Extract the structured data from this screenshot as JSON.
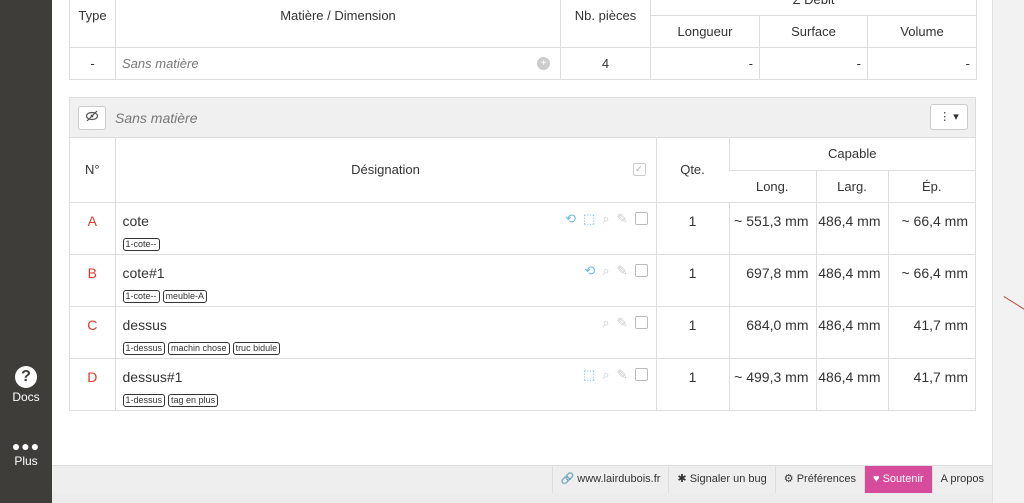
{
  "sidebar": {
    "docs_label": "Docs",
    "docs_icon": "question-icon",
    "plus_label": "Plus",
    "plus_icon": "more-dots-icon"
  },
  "summary": {
    "headers": {
      "type": "Type",
      "material": "Matière / Dimension",
      "count": "Nb. pièces",
      "debit_group": "Σ Débit",
      "length": "Longueur",
      "surface": "Surface",
      "volume": "Volume"
    },
    "row": {
      "type": "-",
      "material": "Sans matière",
      "count": "4",
      "length": "-",
      "surface": "-",
      "volume": "-"
    }
  },
  "group": {
    "title": "Sans matière",
    "headers": {
      "number": "N°",
      "designation": "Désignation",
      "qty": "Qte.",
      "capable": "Capable",
      "long": "Long.",
      "larg": "Larg.",
      "ep": "Ép."
    },
    "parts": [
      {
        "number": "A",
        "name": "cote",
        "tags": [
          "1-cote--"
        ],
        "icons": [
          "rotate-icon",
          "dimension-icon"
        ],
        "qty": "1",
        "long": "~ 551,3 mm",
        "larg": "486,4 mm",
        "ep": "~ 66,4 mm"
      },
      {
        "number": "B",
        "name": "cote#1",
        "tags": [
          "1-cote--",
          "meuble-A"
        ],
        "icons": [
          "rotate-icon"
        ],
        "qty": "1",
        "long": "697,8 mm",
        "larg": "486,4 mm",
        "ep": "~ 66,4 mm"
      },
      {
        "number": "C",
        "name": "dessus",
        "tags": [
          "1-dessus",
          "machin chose",
          "truc bidule"
        ],
        "icons": [],
        "qty": "1",
        "long": "684,0 mm",
        "larg": "486,4 mm",
        "ep": "41,7 mm"
      },
      {
        "number": "D",
        "name": "dessus#1",
        "tags": [
          "1-dessus",
          "tag en plus"
        ],
        "icons": [
          "dimension-icon"
        ],
        "qty": "1",
        "long": "~ 499,3 mm",
        "larg": "486,4 mm",
        "ep": "41,7 mm"
      }
    ]
  },
  "footer": {
    "website": "www.lairdubois.fr",
    "report_bug": "Signaler un bug",
    "preferences": "Préférences",
    "support": "Soutenir",
    "about": "A propos"
  },
  "colors": {
    "accent_support": "#d74b9d",
    "part_number": "#dc3b2b",
    "icon_blue": "#6fb8d8",
    "sidebar_bg": "#3e3d3a"
  }
}
